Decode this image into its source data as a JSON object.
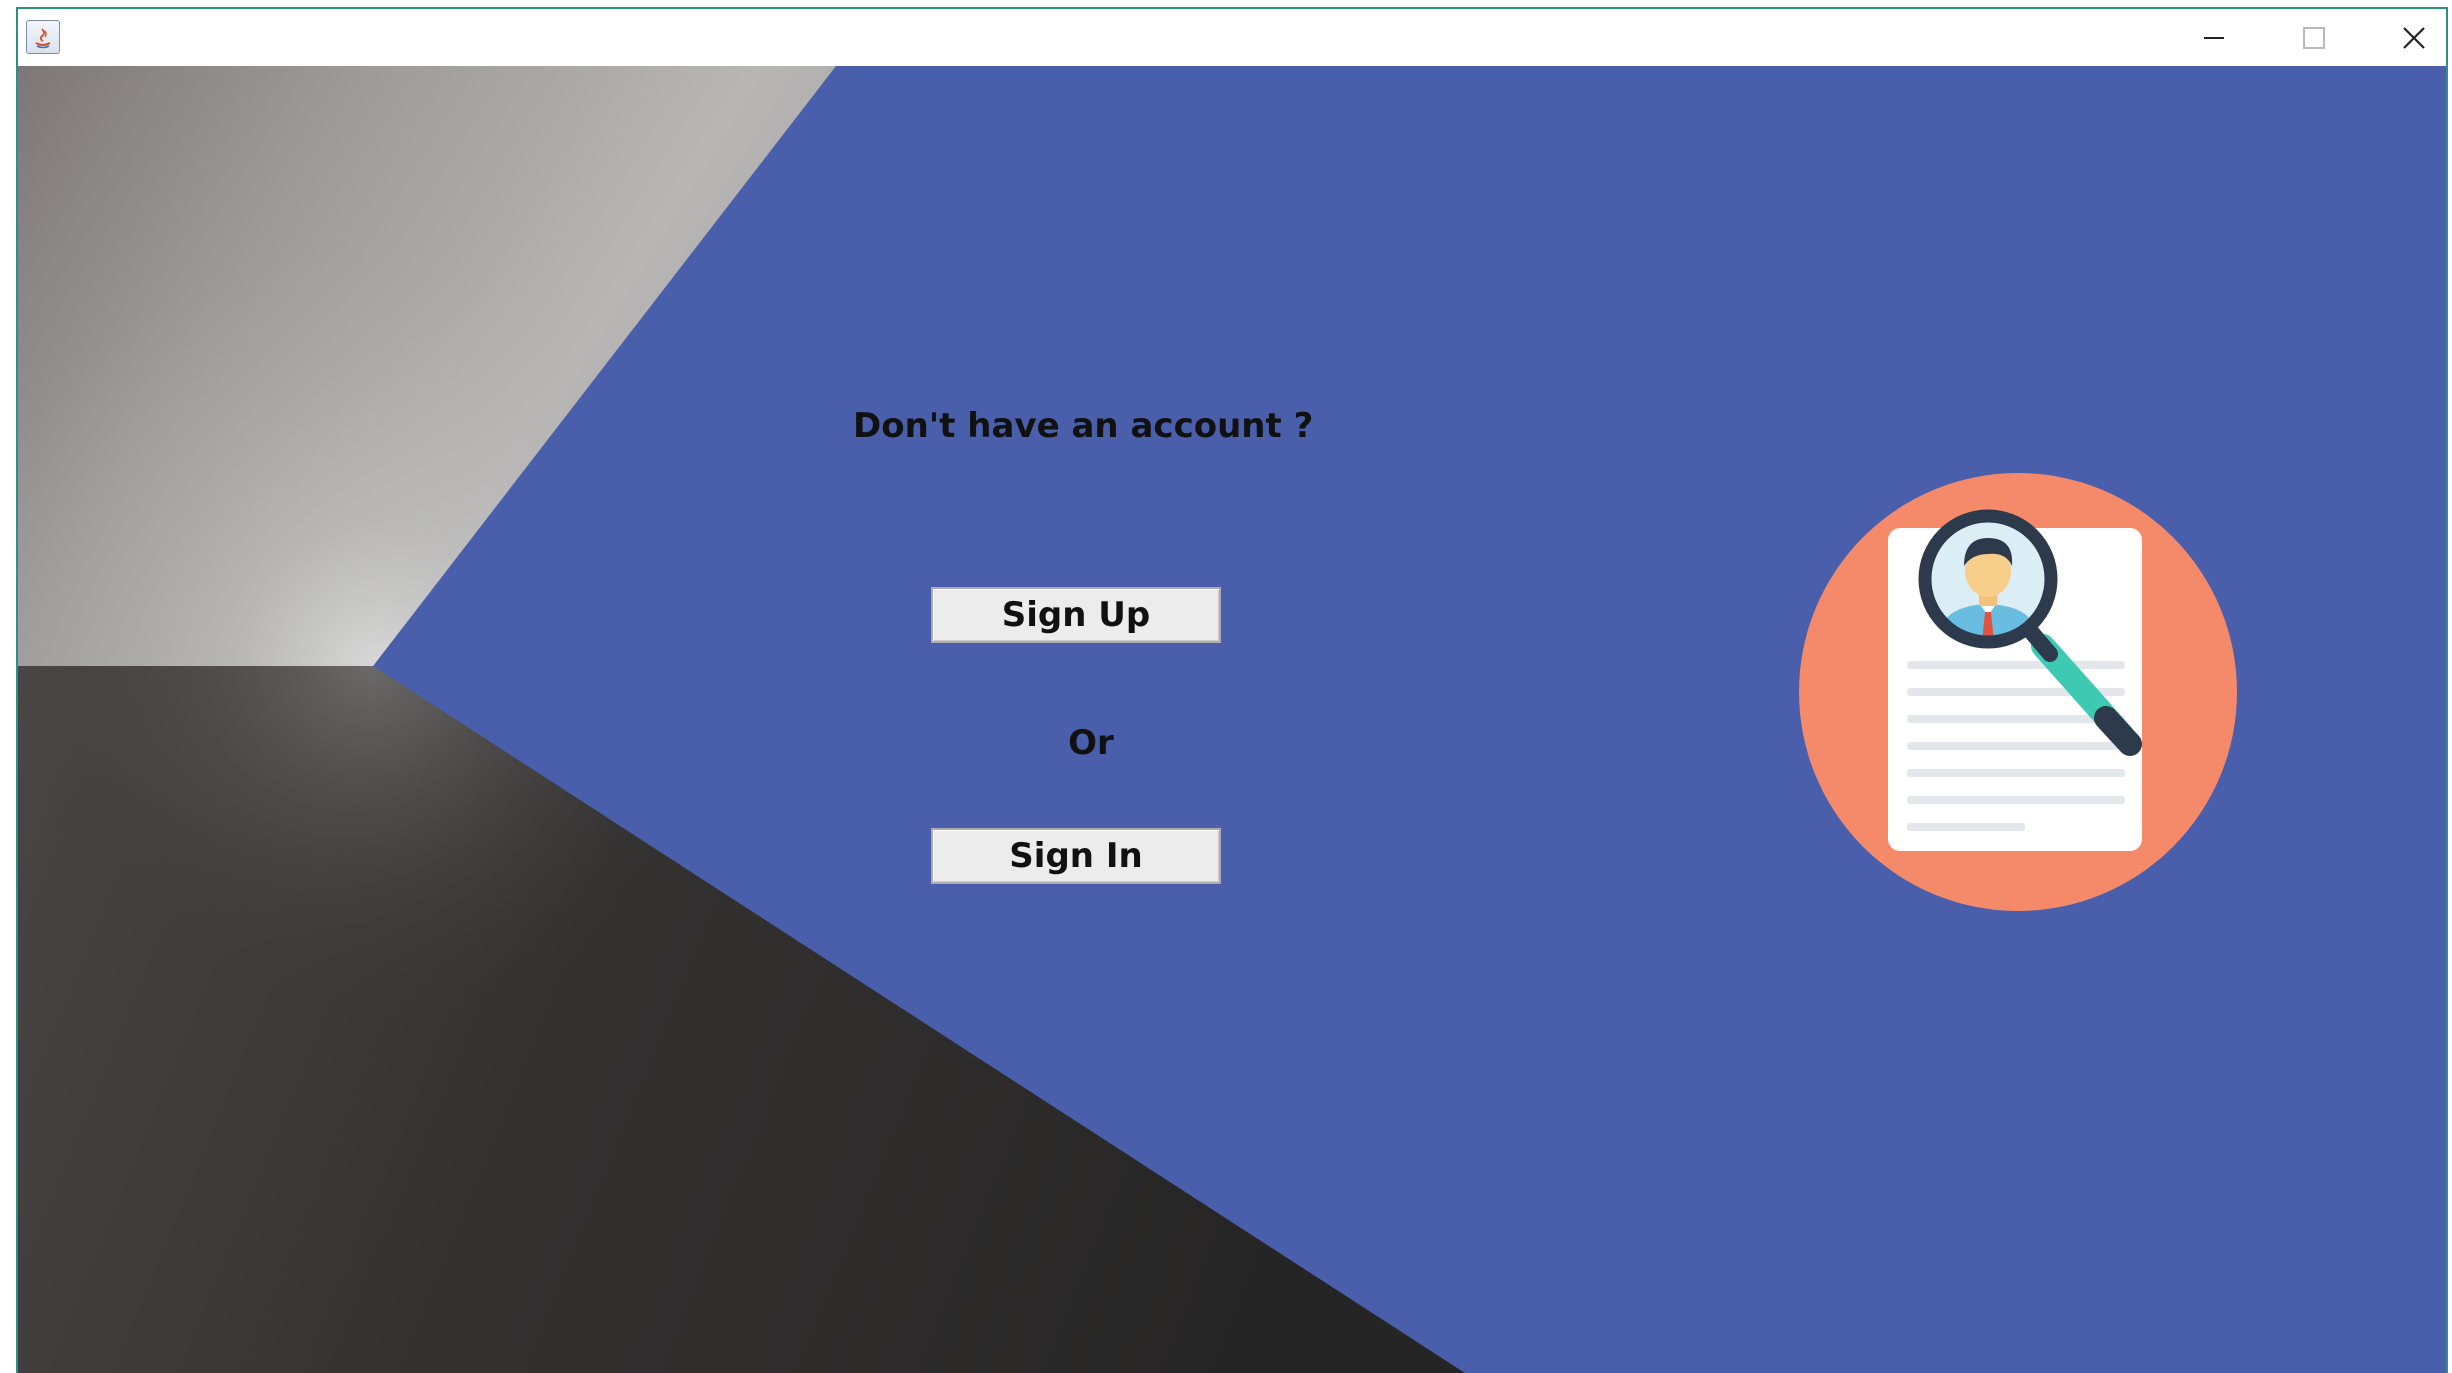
{
  "window": {
    "controls": {
      "minimize_icon": "minimize-icon",
      "maximize_icon": "maximize-icon",
      "close_icon": "close-icon"
    }
  },
  "main": {
    "prompt": "Don't have an account ?",
    "sign_up_label": "Sign Up",
    "or_label": "Or",
    "sign_in_label": "Sign In",
    "illustration_icon": "profile-search-icon"
  },
  "colors": {
    "background_blue": "#4a5fab",
    "illustration_circle": "#f58a6b",
    "magnifier_handle": "#3ec9b3"
  }
}
